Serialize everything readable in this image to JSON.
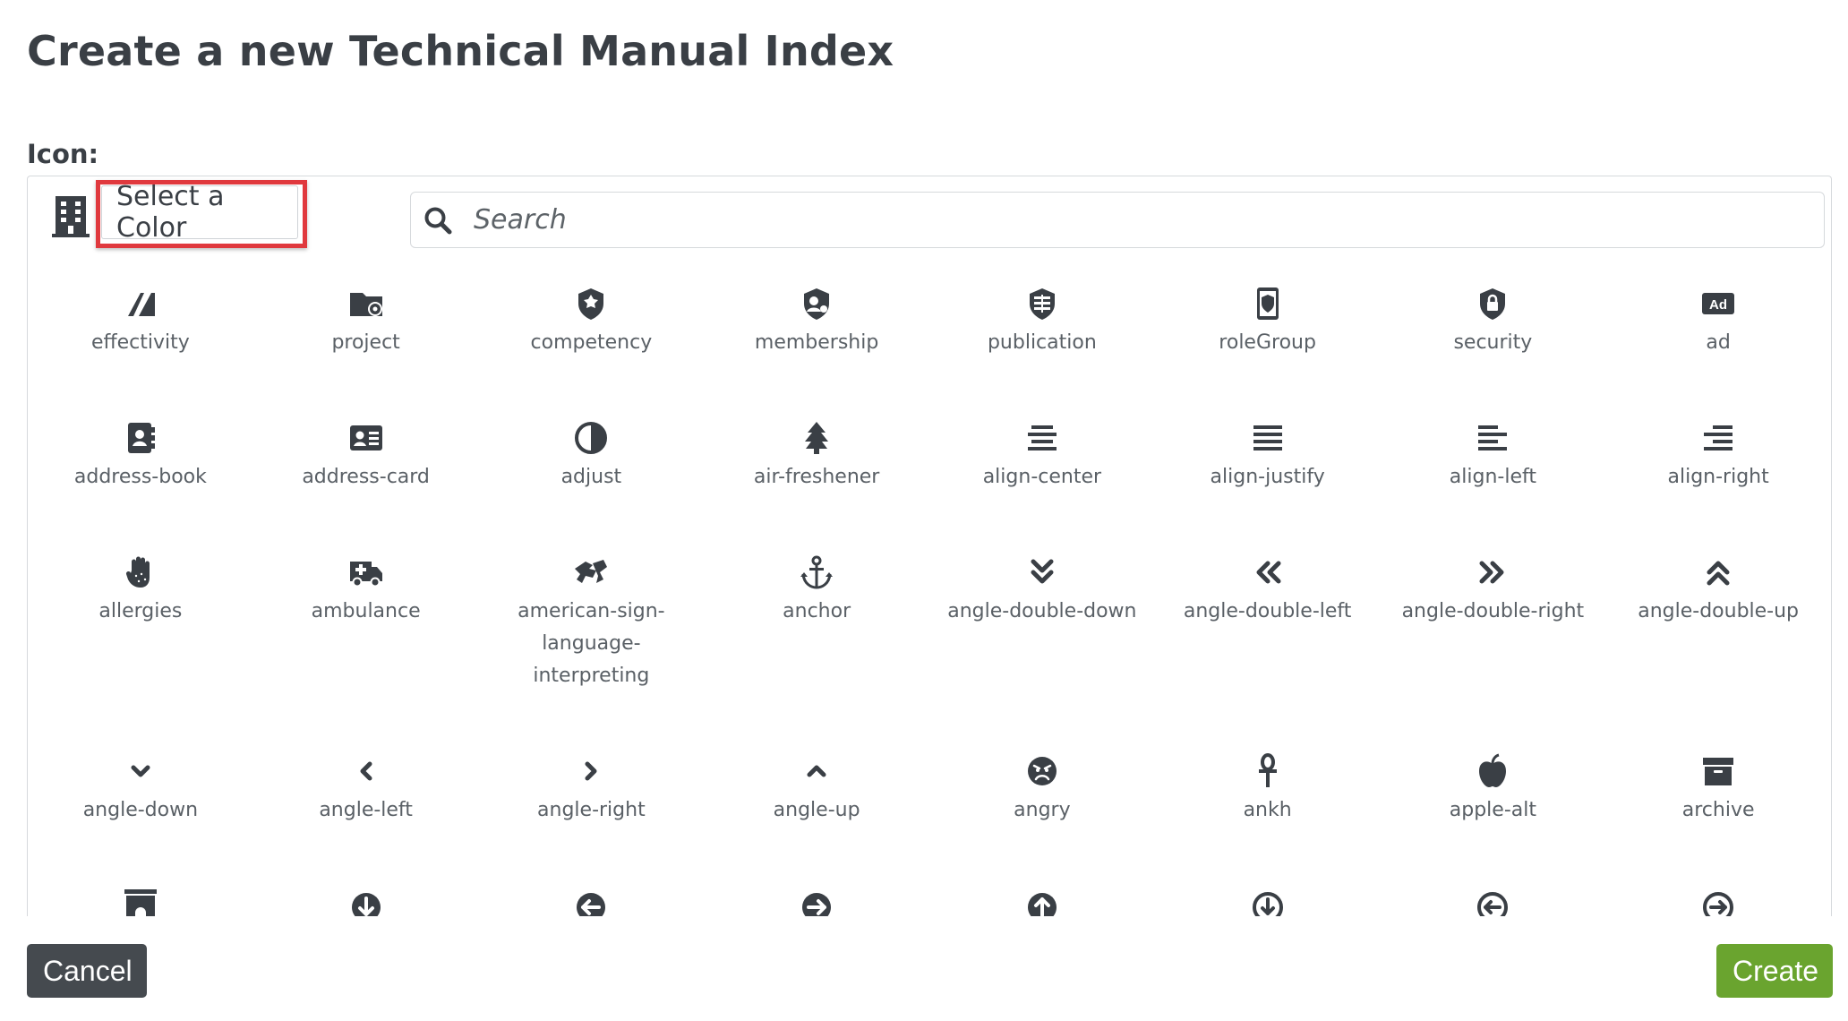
{
  "page": {
    "title": "Create a new Technical Manual Index"
  },
  "icon_field": {
    "label": "Icon:"
  },
  "picker": {
    "selected_icon": "building-icon",
    "color_select_label": "Select a Color",
    "search_placeholder": "Search",
    "rows": [
      [
        {
          "label": "effectivity",
          "icon": "effectivity-icon"
        },
        {
          "label": "project",
          "icon": "folder-cog-icon"
        },
        {
          "label": "competency",
          "icon": "badge-shield-icon"
        },
        {
          "label": "membership",
          "icon": "shield-user-icon"
        },
        {
          "label": "publication",
          "icon": "shield-book-icon"
        },
        {
          "label": "roleGroup",
          "icon": "id-badge-shield-icon"
        },
        {
          "label": "security",
          "icon": "shield-lock-icon"
        },
        {
          "label": "ad",
          "icon": "ad-icon"
        }
      ],
      [
        {
          "label": "address-book",
          "icon": "address-book-icon"
        },
        {
          "label": "address-card",
          "icon": "address-card-icon"
        },
        {
          "label": "adjust",
          "icon": "adjust-icon"
        },
        {
          "label": "air-freshener",
          "icon": "air-freshener-icon"
        },
        {
          "label": "align-center",
          "icon": "align-center-icon"
        },
        {
          "label": "align-justify",
          "icon": "align-justify-icon"
        },
        {
          "label": "align-left",
          "icon": "align-left-icon"
        },
        {
          "label": "align-right",
          "icon": "align-right-icon"
        }
      ],
      [
        {
          "label": "allergies",
          "icon": "allergies-icon"
        },
        {
          "label": "ambulance",
          "icon": "ambulance-icon"
        },
        {
          "label": "american-sign-language-interpreting",
          "icon": "american-sign-language-interpreting-icon"
        },
        {
          "label": "anchor",
          "icon": "anchor-icon"
        },
        {
          "label": "angle-double-down",
          "icon": "angle-double-down-icon"
        },
        {
          "label": "angle-double-left",
          "icon": "angle-double-left-icon"
        },
        {
          "label": "angle-double-right",
          "icon": "angle-double-right-icon"
        },
        {
          "label": "angle-double-up",
          "icon": "angle-double-up-icon"
        }
      ],
      [
        {
          "label": "angle-down",
          "icon": "angle-down-icon"
        },
        {
          "label": "angle-left",
          "icon": "angle-left-icon"
        },
        {
          "label": "angle-right",
          "icon": "angle-right-icon"
        },
        {
          "label": "angle-up",
          "icon": "angle-up-icon"
        },
        {
          "label": "angry",
          "icon": "angry-icon"
        },
        {
          "label": "ankh",
          "icon": "ankh-icon"
        },
        {
          "label": "apple-alt",
          "icon": "apple-alt-icon"
        },
        {
          "label": "archive",
          "icon": "archive-icon"
        }
      ],
      [
        {
          "label": "",
          "icon": "archway-icon"
        },
        {
          "label": "",
          "icon": "arrow-circle-down-icon"
        },
        {
          "label": "",
          "icon": "arrow-circle-left-icon"
        },
        {
          "label": "",
          "icon": "arrow-circle-right-icon"
        },
        {
          "label": "",
          "icon": "arrow-circle-up-icon"
        },
        {
          "label": "",
          "icon": "arrow-circle-down-outline-icon"
        },
        {
          "label": "",
          "icon": "arrow-circle-left-outline-icon"
        },
        {
          "label": "",
          "icon": "arrow-circle-right-outline-icon"
        }
      ]
    ]
  },
  "actions": {
    "cancel_label": "Cancel",
    "create_label": "Create"
  },
  "colors": {
    "text": "#3a3f45",
    "icon": "#3a3f45",
    "highlight": "#e0393e",
    "create": "#6aa42f",
    "cancel": "#454a4f"
  }
}
